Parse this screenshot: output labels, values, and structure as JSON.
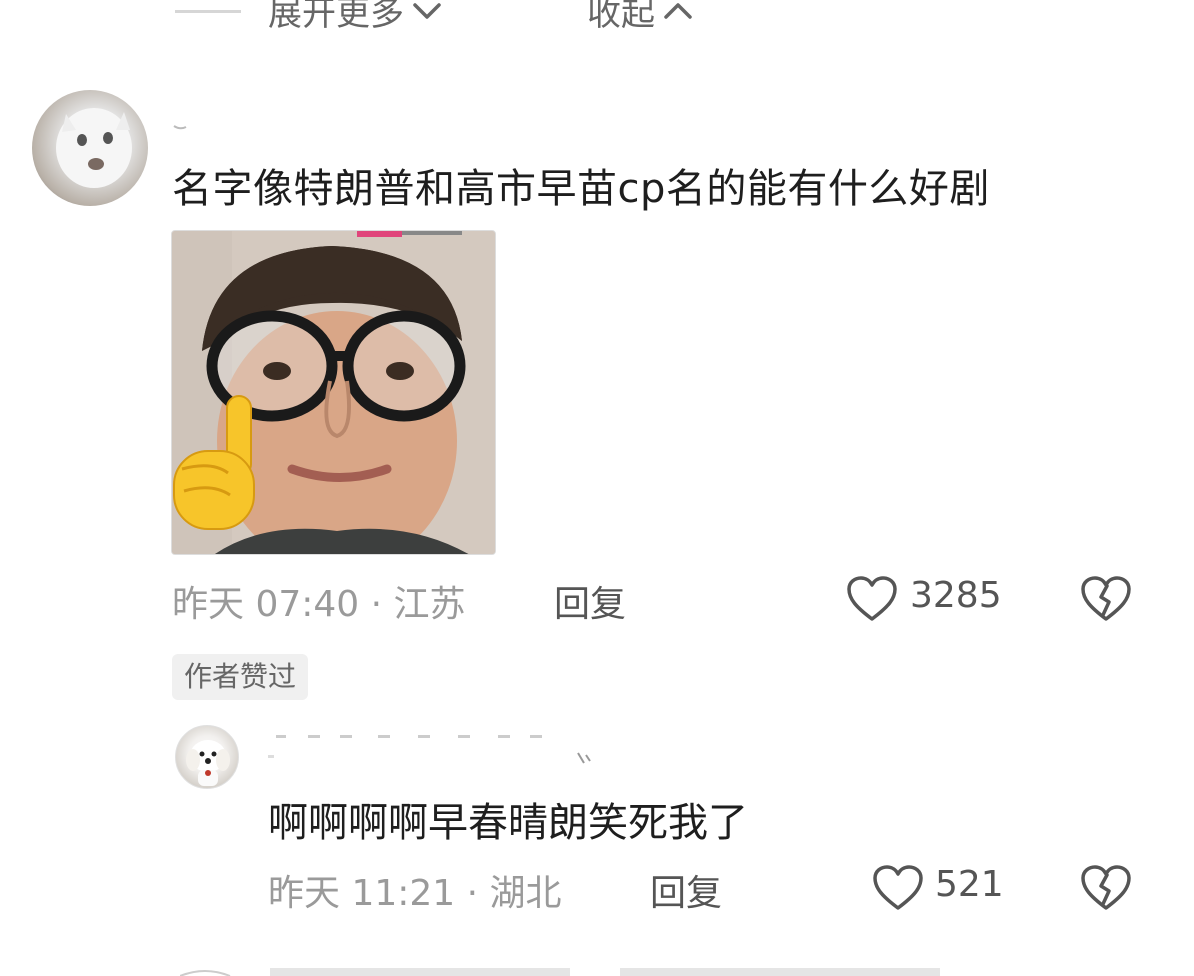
{
  "top": {
    "expand_more": "展开更多",
    "collapse": "收起"
  },
  "comment": {
    "text": "名字像特朗普和高市早苗cp名的能有什么好剧",
    "time_location": "昨天 07:40 · 江苏",
    "reply_label": "回复",
    "like_count": "3285",
    "author_liked_badge": "作者赞过"
  },
  "reply": {
    "text": "啊啊啊啊早春晴朗笑死我了",
    "time_location": "昨天 11:21 · 湖北",
    "reply_label": "回复",
    "like_count": "521"
  },
  "colors": {
    "text_primary": "#1e1e1e",
    "text_meta": "#9a9a9a",
    "icon": "#555555",
    "badge_bg": "#f0f0f0"
  },
  "icons": [
    "chevron-down-icon",
    "chevron-up-icon",
    "heart-icon",
    "broken-heart-icon"
  ]
}
